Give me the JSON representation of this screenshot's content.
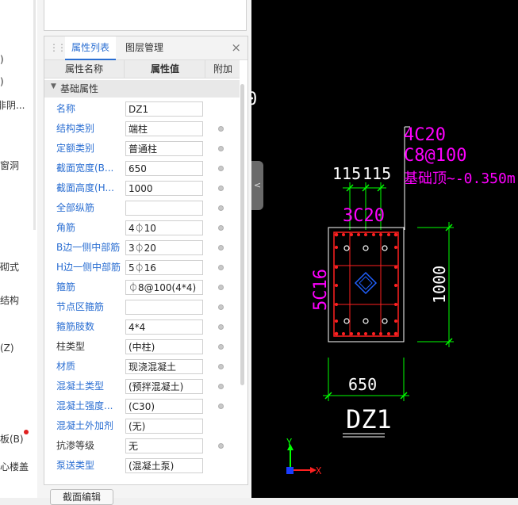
{
  "left_strip": {
    "fragments": [
      ")",
      ")",
      "非阴...",
      "窗洞",
      "砌式",
      "结构",
      "(Z)",
      "板(B)",
      "心楼盖",
      "▲"
    ]
  },
  "panel": {
    "tabs": [
      "属性列表",
      "图层管理"
    ],
    "active_tab": "属性列表",
    "close_label": "×",
    "columns": {
      "name": "属性名称",
      "value": "属性值",
      "extra": "附加"
    },
    "group": "基础属性",
    "rows": [
      {
        "name": "名称",
        "value": "DZ1",
        "color": "blue",
        "dot": false
      },
      {
        "name": "结构类别",
        "value": "端柱",
        "color": "blue",
        "dot": true
      },
      {
        "name": "定额类别",
        "value": "普通柱",
        "color": "blue",
        "dot": true
      },
      {
        "name": "截面宽度(B...",
        "value": "650",
        "color": "blue",
        "dot": true
      },
      {
        "name": "截面高度(H...",
        "value": "1000",
        "color": "blue",
        "dot": true
      },
      {
        "name": "全部纵筋",
        "value": "",
        "color": "blue",
        "dot": true
      },
      {
        "name": "角筋",
        "value": "4⏀10",
        "color": "blue",
        "dot": true
      },
      {
        "name": "B边一侧中部筋",
        "value": "3⏀20",
        "color": "blue",
        "dot": true
      },
      {
        "name": "H边一侧中部筋",
        "value": "5⏀16",
        "color": "blue",
        "dot": true
      },
      {
        "name": "箍筋",
        "value": "⏀8@100(4*4)",
        "color": "blue",
        "dot": true
      },
      {
        "name": "节点区箍筋",
        "value": "",
        "color": "blue",
        "dot": true
      },
      {
        "name": "箍筋肢数",
        "value": "4*4",
        "color": "blue",
        "dot": true
      },
      {
        "name": "柱类型",
        "value": "(中柱)",
        "color": "black",
        "dot": true
      },
      {
        "name": "材质",
        "value": "现浇混凝土",
        "color": "blue",
        "dot": true
      },
      {
        "name": "混凝土类型",
        "value": "(预拌混凝土)",
        "color": "blue",
        "dot": true
      },
      {
        "name": "混凝土强度...",
        "value": "(C30)",
        "color": "blue",
        "dot": true
      },
      {
        "name": "混凝土外加剂",
        "value": "(无)",
        "color": "blue",
        "dot": false
      },
      {
        "name": "抗渗等级",
        "value": "无",
        "color": "black",
        "dot": true
      },
      {
        "name": "泵送类型",
        "value": "(混凝土泵)",
        "color": "blue",
        "dot": false
      }
    ],
    "section_button": "截面编辑"
  },
  "cad": {
    "annotation": [
      "4C20",
      "C8@100",
      "基础顶~-0.350m"
    ],
    "dim_115_left": "115",
    "dim_115_right": "115",
    "top_rebar": "3C20",
    "side_rebar": "5C16",
    "dim_height": "1000",
    "dim_width": "650",
    "column_name": "DZ1",
    "partial_text": "0",
    "axis_y": "Y",
    "axis_x": "X"
  },
  "colors": {
    "accent": "#2a6ed2",
    "magenta": "#ff00ff",
    "green": "#00ff00",
    "red": "#ff0000",
    "cad_bg": "#000000"
  }
}
